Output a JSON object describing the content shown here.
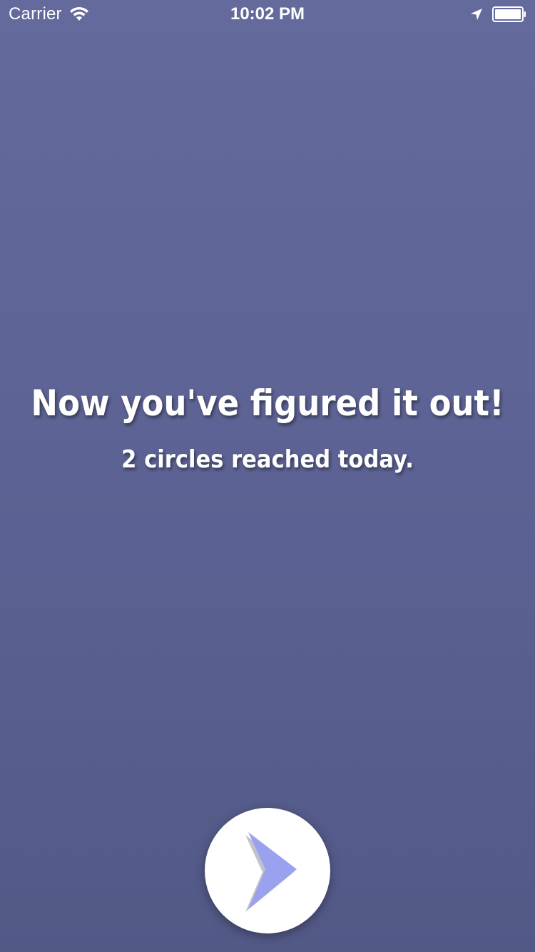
{
  "status_bar": {
    "carrier": "Carrier",
    "time": "10:02 PM",
    "icons": [
      "wifi-icon",
      "location-arrow-icon",
      "battery-icon"
    ]
  },
  "message": {
    "headline": "Now you've figured it out!",
    "subline": "2 circles reached today."
  },
  "next_button": {
    "icon": "chevron-right-arrow-icon",
    "icon_color": "#9aa2ef"
  },
  "colors": {
    "background_top": "#646a9c",
    "background_bottom": "#535987",
    "text": "#ffffff",
    "button": "#ffffff"
  }
}
